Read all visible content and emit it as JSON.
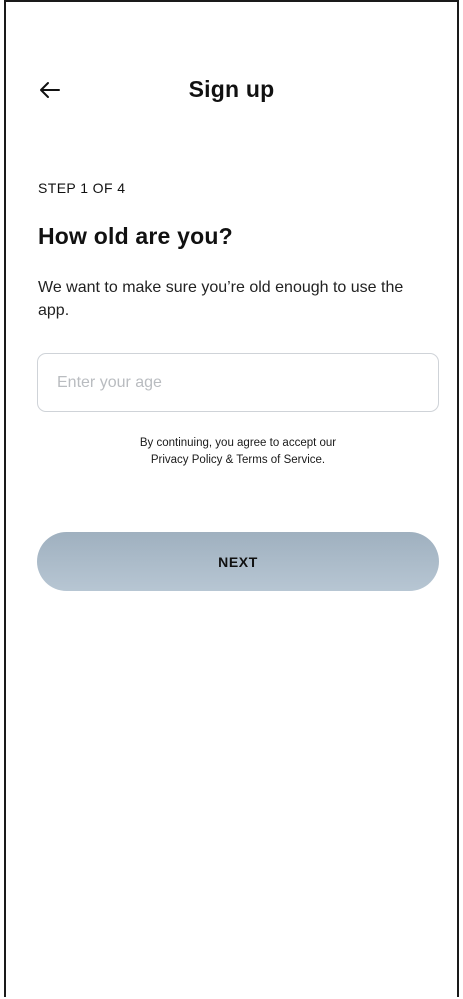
{
  "header": {
    "back_icon": "arrow-left-icon",
    "title": "Sign up"
  },
  "step": {
    "label": "STEP 1 OF 4"
  },
  "question": {
    "title": "How old are you?",
    "description": "We want to make sure you’re old enough to use the app."
  },
  "age_input": {
    "value": "",
    "placeholder": "Enter your age"
  },
  "consent": {
    "line1": "By continuing, you agree to accept our",
    "line2": "Privacy Policy & Terms of Service."
  },
  "next_button": {
    "label": "NEXT"
  },
  "colors": {
    "button_gradient_top": "#9fb0bf",
    "button_gradient_bottom": "#b7c6d3",
    "input_border": "#cfd3d8",
    "placeholder": "#b9bcc0"
  }
}
